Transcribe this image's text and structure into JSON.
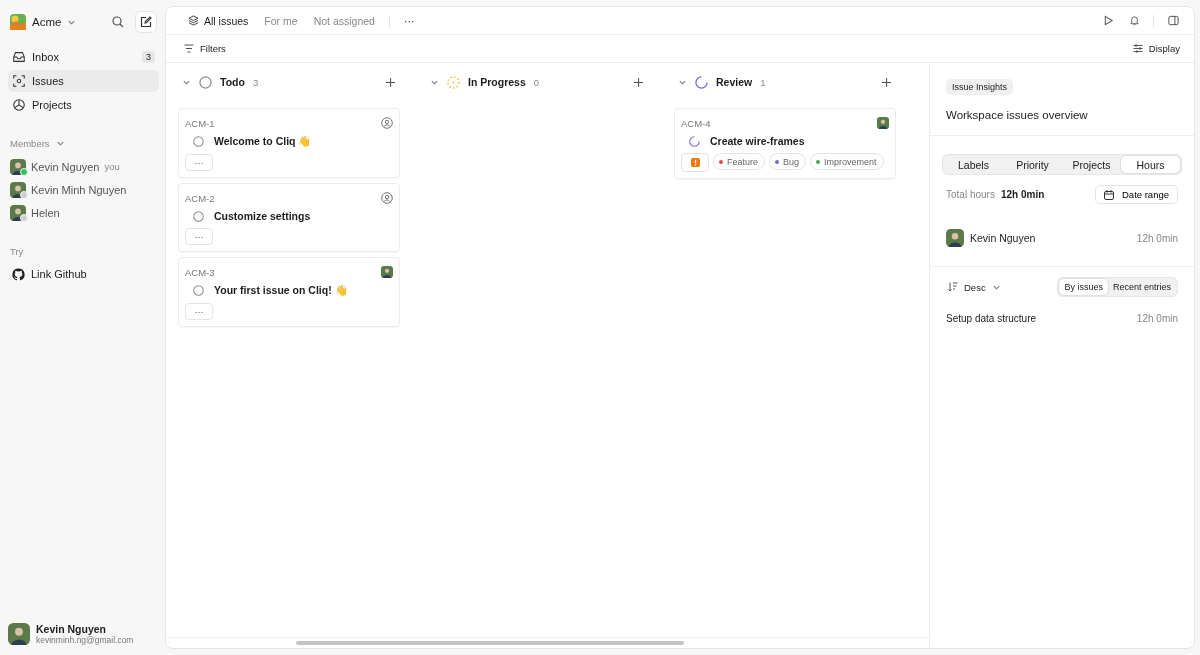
{
  "workspace": {
    "name": "Acme"
  },
  "sidebar": {
    "items": [
      {
        "label": "Inbox",
        "badge": "3",
        "selected": false
      },
      {
        "label": "Issues",
        "selected": true
      },
      {
        "label": "Projects",
        "selected": false
      }
    ],
    "members_heading": "Members",
    "members": [
      {
        "name": "Kevin Nguyen",
        "suffix": "you",
        "online": true
      },
      {
        "name": "Kevin Minh Nguyen",
        "online": false
      },
      {
        "name": "Helen",
        "online": false
      }
    ],
    "try_heading": "Try",
    "try_items": [
      {
        "label": "Link Github"
      }
    ],
    "user": {
      "name": "Kevin Nguyen",
      "email": "kevinminh.ng@gmail.com"
    }
  },
  "tabs": [
    {
      "label": "All issues",
      "selected": true
    },
    {
      "label": "For me",
      "selected": false
    },
    {
      "label": "Not assigned",
      "selected": false
    }
  ],
  "more": "···",
  "filters": "Filters",
  "display": "Display",
  "columns": [
    {
      "title": "Todo",
      "kind": "todo",
      "count": "3",
      "cards": [
        {
          "id": "ACM-1",
          "title": "Welcome to Cliq 👋",
          "assigned": false,
          "more": "···"
        },
        {
          "id": "ACM-2",
          "title": "Customize settings",
          "assigned": false,
          "more": "···"
        },
        {
          "id": "ACM-3",
          "title": "Your first issue on Cliq! 👋",
          "assigned": true,
          "more": "···"
        }
      ]
    },
    {
      "title": "In Progress",
      "kind": "in_progress",
      "count": "0"
    },
    {
      "title": "Review",
      "kind": "review",
      "count": "1",
      "cards": [
        {
          "id": "ACM-4",
          "title": "Create wire-frames",
          "assigned": true,
          "urgent": true,
          "labels": [
            {
              "name": "Feature",
              "color": "#e5484d"
            },
            {
              "name": "Bug",
              "color": "#6e6ade"
            },
            {
              "name": "Improvement",
              "color": "#46a758"
            }
          ]
        }
      ]
    }
  ],
  "insights": {
    "badge": "Issue Insights",
    "title": "Workspace issues overview",
    "tabs": [
      {
        "label": "Labels",
        "selected": false
      },
      {
        "label": "Priority",
        "selected": false
      },
      {
        "label": "Projects",
        "selected": false
      },
      {
        "label": "Hours",
        "selected": true
      }
    ],
    "total_label": "Total hours",
    "total_value": "12h 0min",
    "date_range": "Date range",
    "people": [
      {
        "name": "Kevin Nguyen",
        "hours": "12h 0min"
      }
    ],
    "sort": "Desc",
    "views": [
      {
        "label": "By issues",
        "selected": true
      },
      {
        "label": "Recent entries",
        "selected": false
      }
    ],
    "entries": [
      {
        "name": "Setup data structure",
        "hours": "12h 0min"
      }
    ]
  }
}
